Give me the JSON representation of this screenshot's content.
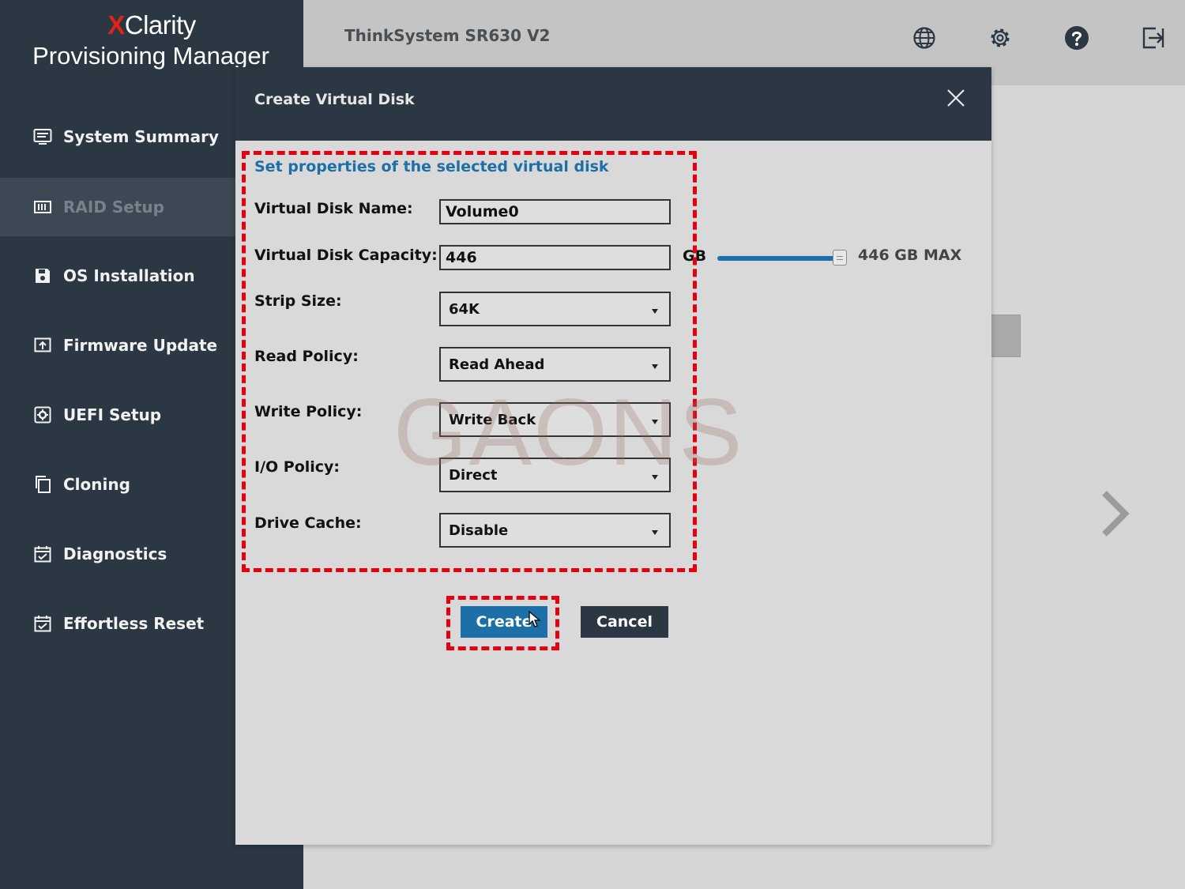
{
  "brand": {
    "x": "X",
    "clarity": "Clarity",
    "subtitle": "Provisioning Manager"
  },
  "header": {
    "product": "ThinkSystem SR630 V2",
    "icons": [
      "globe-icon",
      "gear-icon",
      "help-icon",
      "logout-icon"
    ]
  },
  "sidebar": {
    "items": [
      {
        "label": "System Summary",
        "icon": "summary-icon",
        "active": false
      },
      {
        "label": "RAID Setup",
        "icon": "raid-icon",
        "active": true
      },
      {
        "label": "OS Installation",
        "icon": "save-icon",
        "active": false
      },
      {
        "label": "Firmware Update",
        "icon": "firmware-icon",
        "active": false
      },
      {
        "label": "UEFI Setup",
        "icon": "uefi-icon",
        "active": false
      },
      {
        "label": "Cloning",
        "icon": "copy-icon",
        "active": false
      },
      {
        "label": "Diagnostics",
        "icon": "calendar-check-icon",
        "active": false
      },
      {
        "label": "Effortless Reset",
        "icon": "calendar-check-icon",
        "active": false
      }
    ]
  },
  "dialog": {
    "title": "Create Virtual Disk",
    "section_title": "Set properties of the selected virtual disk",
    "fields": {
      "name": {
        "label": "Virtual Disk Name:",
        "value": "Volume0"
      },
      "capacity": {
        "label": "Virtual Disk Capacity:",
        "value": "446",
        "unit": "GB",
        "max_label": "446 GB MAX",
        "slider_fraction": 1.0
      },
      "strip": {
        "label": "Strip Size:",
        "value": "64K"
      },
      "read": {
        "label": "Read Policy:",
        "value": "Read Ahead"
      },
      "write": {
        "label": "Write Policy:",
        "value": "Write Back"
      },
      "io": {
        "label": "I/O Policy:",
        "value": "Direct"
      },
      "cache": {
        "label": "Drive Cache:",
        "value": "Disable"
      }
    },
    "buttons": {
      "create": "Create",
      "cancel": "Cancel"
    }
  },
  "watermark": "GAONS",
  "colors": {
    "sidebar": "#2b3843",
    "accent": "#1d6fa8",
    "highlight": "#e3000f",
    "brand_x": "#e2231a"
  }
}
